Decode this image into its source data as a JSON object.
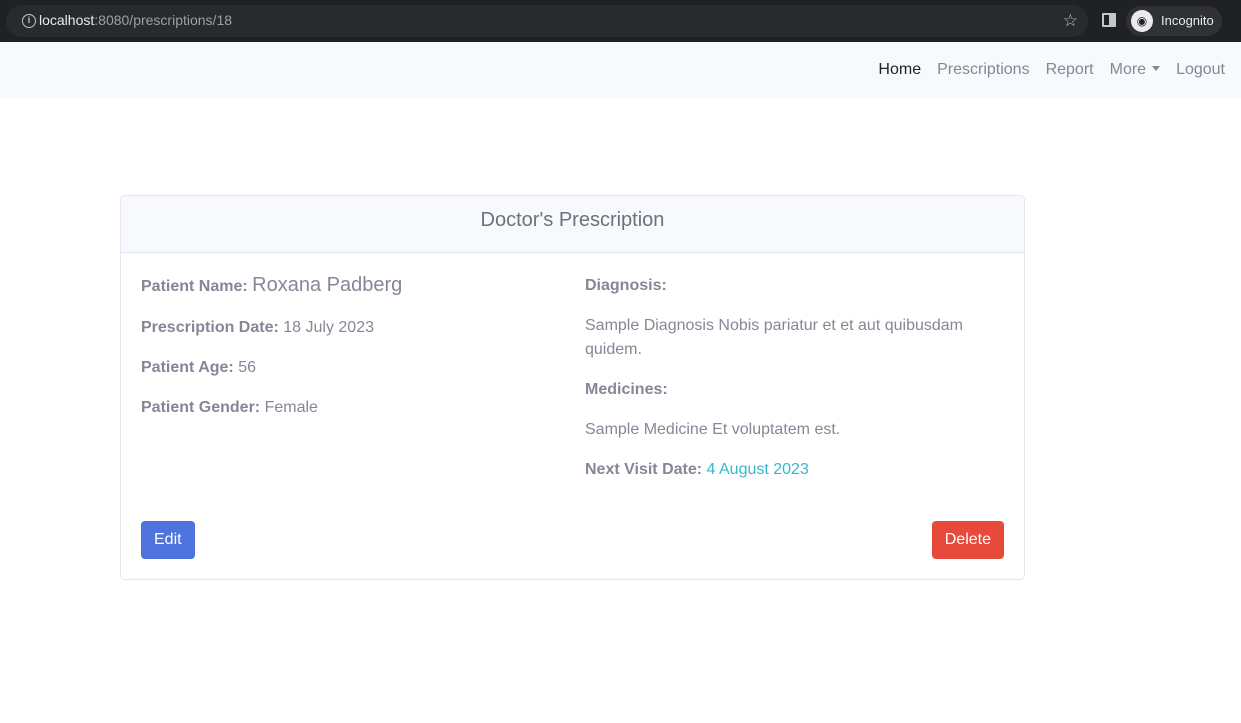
{
  "browser": {
    "url_host": "localhost",
    "url_path": ":8080/prescriptions/18",
    "profile_label": "Incognito"
  },
  "navbar": {
    "links": [
      {
        "label": "Home",
        "active": true
      },
      {
        "label": "Prescriptions",
        "active": false
      },
      {
        "label": "Report",
        "active": false
      },
      {
        "label": "More",
        "active": false
      },
      {
        "label": "Logout",
        "active": false
      }
    ]
  },
  "card": {
    "title": "Doctor's Prescription",
    "patient_name_label": "Patient Name:",
    "patient_name": "Roxana Padberg",
    "prescription_date_label": "Prescription Date:",
    "prescription_date": "18 July 2023",
    "patient_age_label": "Patient Age:",
    "patient_age": "56",
    "patient_gender_label": "Patient Gender:",
    "patient_gender": "Female",
    "diagnosis_label": "Diagnosis:",
    "diagnosis": "Sample Diagnosis Nobis pariatur et et aut quibusdam quidem.",
    "medicines_label": "Medicines:",
    "medicines": "Sample Medicine Et voluptatem est.",
    "next_visit_label": "Next Visit Date:",
    "next_visit_date": "4 August 2023",
    "edit_label": "Edit",
    "delete_label": "Delete"
  },
  "colors": {
    "primary": "#4e73df",
    "danger": "#e74a3b",
    "info": "#36b9cc",
    "text": "#858796"
  }
}
